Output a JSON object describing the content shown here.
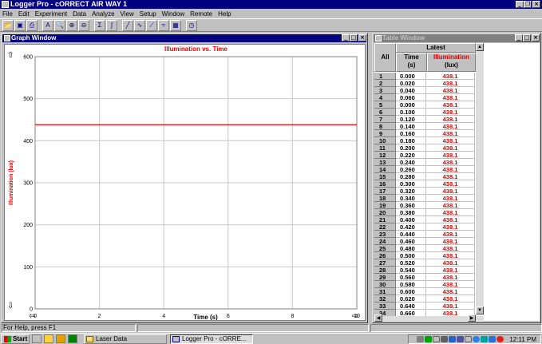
{
  "app": {
    "title": "Logger Pro - cORRECT AIR WAY 1"
  },
  "menu": [
    "File",
    "Edit",
    "Experiment",
    "Data",
    "Analyze",
    "View",
    "Setup",
    "Window",
    "Remote",
    "Help"
  ],
  "graph_window": {
    "title": "Graph Window"
  },
  "table_window": {
    "title": "Table Window",
    "all_label": "All",
    "group_label": "Latest",
    "col_time": "Time",
    "col_time_unit": "(s)",
    "col_illum": "Illumination",
    "col_illum_unit": "(lux)"
  },
  "chart_data": {
    "type": "line",
    "title": "Illumination vs. Time",
    "xlabel": "Time (s)",
    "ylabel": "Illumination (lux)",
    "xlim": [
      0,
      10
    ],
    "ylim": [
      0,
      600
    ],
    "xticks": [
      0,
      2,
      4,
      6,
      8,
      10
    ],
    "yticks": [
      0,
      100,
      200,
      300,
      400,
      500,
      600
    ],
    "grid": true,
    "series": [
      {
        "color": "#e00000",
        "x": [
          0,
          10
        ],
        "y": [
          438.1,
          438.1
        ]
      }
    ]
  },
  "table_rows": [
    {
      "n": "1",
      "t": "0.000",
      "l": "438.1"
    },
    {
      "n": "2",
      "t": "0.020",
      "l": "438.1"
    },
    {
      "n": "3",
      "t": "0.040",
      "l": "438.1"
    },
    {
      "n": "4",
      "t": "0.060",
      "l": "438.1"
    },
    {
      "n": "5",
      "t": "0.000",
      "l": "438.1"
    },
    {
      "n": "6",
      "t": "0.100",
      "l": "438.1"
    },
    {
      "n": "7",
      "t": "0.120",
      "l": "438.1"
    },
    {
      "n": "8",
      "t": "0.140",
      "l": "438.1"
    },
    {
      "n": "9",
      "t": "0.160",
      "l": "438.1"
    },
    {
      "n": "10",
      "t": "0.180",
      "l": "438.1"
    },
    {
      "n": "11",
      "t": "0.200",
      "l": "438.1"
    },
    {
      "n": "12",
      "t": "0.220",
      "l": "438.1"
    },
    {
      "n": "13",
      "t": "0.240",
      "l": "438.1"
    },
    {
      "n": "14",
      "t": "0.260",
      "l": "438.1"
    },
    {
      "n": "15",
      "t": "0.280",
      "l": "438.1"
    },
    {
      "n": "16",
      "t": "0.300",
      "l": "438.1"
    },
    {
      "n": "17",
      "t": "0.320",
      "l": "438.1"
    },
    {
      "n": "18",
      "t": "0.340",
      "l": "438.1"
    },
    {
      "n": "19",
      "t": "0.360",
      "l": "438.1"
    },
    {
      "n": "20",
      "t": "0.380",
      "l": "438.1"
    },
    {
      "n": "21",
      "t": "0.400",
      "l": "438.1"
    },
    {
      "n": "22",
      "t": "0.420",
      "l": "438.1"
    },
    {
      "n": "23",
      "t": "0.440",
      "l": "438.1"
    },
    {
      "n": "24",
      "t": "0.460",
      "l": "438.1"
    },
    {
      "n": "25",
      "t": "0.480",
      "l": "438.1"
    },
    {
      "n": "26",
      "t": "0.500",
      "l": "438.1"
    },
    {
      "n": "27",
      "t": "0.520",
      "l": "438.1"
    },
    {
      "n": "28",
      "t": "0.540",
      "l": "438.1"
    },
    {
      "n": "29",
      "t": "0.560",
      "l": "438.1"
    },
    {
      "n": "30",
      "t": "0.580",
      "l": "438.1"
    },
    {
      "n": "31",
      "t": "0.600",
      "l": "438.1"
    },
    {
      "n": "32",
      "t": "0.620",
      "l": "438.1"
    },
    {
      "n": "33",
      "t": "0.640",
      "l": "438.1"
    },
    {
      "n": "34",
      "t": "0.660",
      "l": "438.1"
    }
  ],
  "status": {
    "help_text": "For Help, press F1"
  },
  "taskbar": {
    "start": "Start",
    "tasks": [
      "Laser Data",
      "Logger Pro - cORRE..."
    ],
    "clock": "12:11 PM"
  }
}
